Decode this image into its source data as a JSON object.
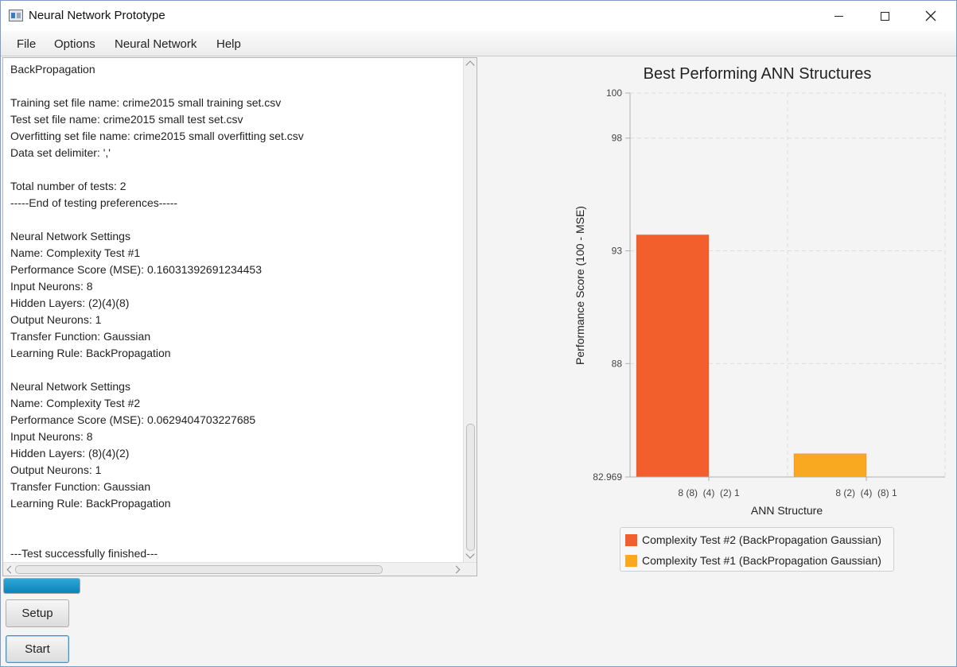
{
  "window": {
    "title": "Neural Network Prototype"
  },
  "menu": {
    "file": "File",
    "options": "Options",
    "neural_network": "Neural Network",
    "help": "Help"
  },
  "log": {
    "lines": [
      "BackPropagation",
      "",
      "Training set file name: crime2015 small training set.csv",
      "Test set file name: crime2015 small test set.csv",
      "Overfitting set file name: crime2015 small overfitting set.csv",
      "Data set delimiter: ','",
      "",
      "Total number of tests: 2",
      "-----End of testing preferences-----",
      "",
      "Neural Network Settings",
      "Name: Complexity Test #1",
      "Performance Score (MSE): 0.16031392691234453",
      "Input Neurons: 8",
      "Hidden Layers: (2)(4)(8)",
      "Output Neurons: 1",
      "Transfer Function: Gaussian",
      "Learning Rule: BackPropagation",
      "",
      "Neural Network Settings",
      "Name: Complexity Test #2",
      "Performance Score (MSE): 0.0629404703227685",
      "Input Neurons: 8",
      "Hidden Layers: (8)(4)(2)",
      "Output Neurons: 1",
      "Transfer Function: Gaussian",
      "Learning Rule: BackPropagation",
      "",
      "",
      "---Test successfully finished---"
    ]
  },
  "progress": {
    "fraction": 1.0
  },
  "buttons": {
    "setup": "Setup",
    "start": "Start"
  },
  "colors": {
    "series1": "#f25f2c",
    "series2": "#f9a91f",
    "progress": "#0c84b8"
  },
  "chart_data": {
    "type": "bar",
    "title": "Best Performing ANN Structures",
    "xlabel": "ANN Structure",
    "ylabel": "Performance Score (100 - MSE)",
    "ylim": [
      82.969,
      100
    ],
    "yticks": [
      82.969,
      88,
      93,
      98,
      100
    ],
    "ytick_labels": [
      "82.969",
      "88",
      "93",
      "98",
      "100"
    ],
    "grid": true,
    "legend_position": "bottom",
    "categories": [
      "8 (8)  (4)  (2) 1",
      "8 (2)  (4)  (8) 1"
    ],
    "series": [
      {
        "name": "Complexity Test #2 (BackPropagation Gaussian)",
        "values": [
          93.71,
          null
        ],
        "color": "#f25f2c"
      },
      {
        "name": "Complexity Test #1 (BackPropagation Gaussian)",
        "values": [
          null,
          84.0
        ],
        "color": "#f9a91f"
      }
    ]
  }
}
